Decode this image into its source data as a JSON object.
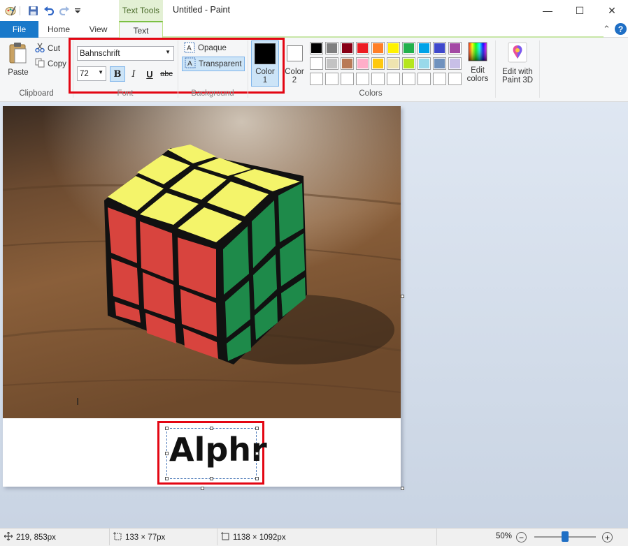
{
  "window": {
    "title": "Untitled - Paint",
    "context_tab": "Text Tools",
    "minimize_glyph": "—",
    "maximize_glyph": "☐",
    "close_glyph": "✕"
  },
  "tabs": {
    "file": "File",
    "home": "Home",
    "view": "View",
    "text": "Text",
    "help_glyph": "?",
    "collapse_glyph": "⌃"
  },
  "clipboard": {
    "paste": "Paste",
    "cut": "Cut",
    "copy": "Copy",
    "group": "Clipboard"
  },
  "font": {
    "family": "Bahnschrift",
    "size": "72",
    "bold": "B",
    "italic": "I",
    "underline": "U",
    "strikethrough": "abc",
    "group": "Font"
  },
  "background": {
    "opaque": "Opaque",
    "transparent": "Transparent",
    "group": "Background"
  },
  "colors": {
    "color1_label": "Color",
    "color1_num": "1",
    "color2_label": "Color",
    "color2_num": "2",
    "color1_value": "#000000",
    "color2_value": "#ffffff",
    "edit_colors_line1": "Edit",
    "edit_colors_line2": "colors",
    "paint3d_line1": "Edit with",
    "paint3d_line2": "Paint 3D",
    "group": "Colors",
    "palette_row1": [
      "#000000",
      "#7f7f7f",
      "#880015",
      "#ed1c24",
      "#ff7f27",
      "#fff200",
      "#22b14c",
      "#00a2e8",
      "#3f48cc",
      "#a349a4"
    ],
    "palette_row2": [
      "#ffffff",
      "#c3c3c3",
      "#b97a57",
      "#ffaec9",
      "#ffc90e",
      "#efe4b0",
      "#b5e61d",
      "#99d9ea",
      "#7092be",
      "#c8bfe7"
    ],
    "palette_row3": [
      "#ffffff",
      "#ffffff",
      "#ffffff",
      "#ffffff",
      "#ffffff",
      "#ffffff",
      "#ffffff",
      "#ffffff",
      "#ffffff",
      "#ffffff"
    ]
  },
  "canvas": {
    "text": "Alphr"
  },
  "status": {
    "cursor_pos": "219, 853px",
    "selection_size": "133 × 77px",
    "image_size": "1138 × 1092px",
    "zoom": "50%",
    "zoom_level": 0.5
  },
  "icons": [
    "paint-app-icon",
    "save-icon",
    "undo-icon",
    "redo-icon",
    "customize-qat-icon",
    "paste-icon",
    "cut-icon",
    "copy-icon",
    "opaque-icon",
    "transparent-icon",
    "edit-colors-icon",
    "paint3d-icon",
    "cursor-position-icon",
    "selection-size-icon",
    "image-size-icon",
    "zoom-out-icon",
    "zoom-in-icon",
    "help-icon"
  ]
}
